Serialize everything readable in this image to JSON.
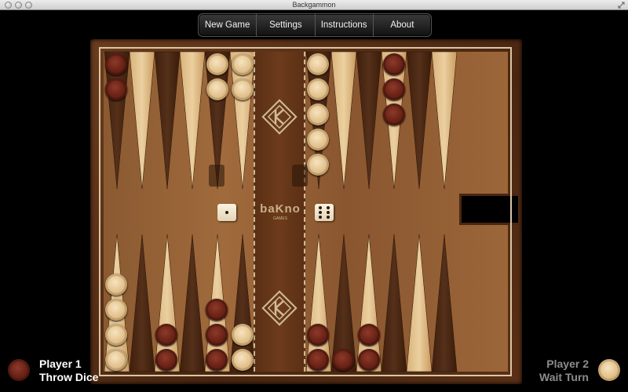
{
  "window": {
    "title": "Backgammon"
  },
  "menu": {
    "items": [
      "New Game",
      "Settings",
      "Instructions",
      "About"
    ]
  },
  "board": {
    "logo": "baKno",
    "logo_sub": "GAMES"
  },
  "dice": [
    {
      "value": 1
    },
    {
      "value": 6
    }
  ],
  "players": [
    {
      "name": "Player 1",
      "status": "Throw Dice",
      "color": "dark"
    },
    {
      "name": "Player 2",
      "status": "Wait Turn",
      "color": "light"
    }
  ]
}
